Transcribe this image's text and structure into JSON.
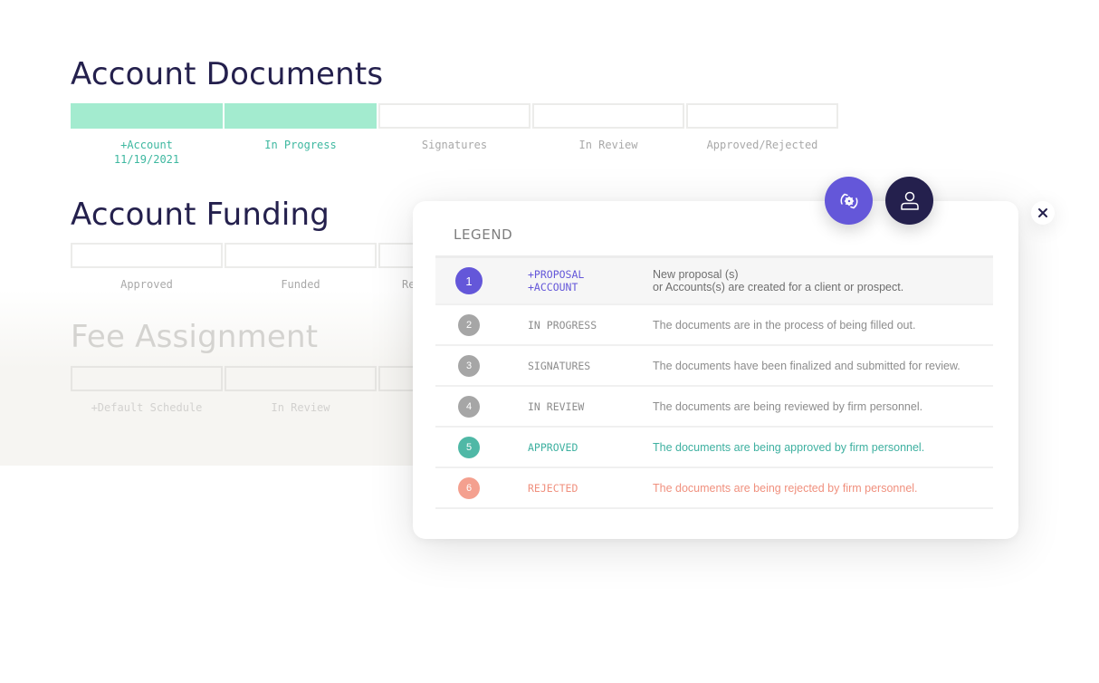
{
  "colors": {
    "navy": "#24204d",
    "purple": "#6457d9",
    "mint": "#a3ebcf",
    "teal": "#3eb8a0",
    "gray": "#a6a6a6",
    "salmon": "#f4a08f",
    "text_gray": "#8a8a8a"
  },
  "sections": [
    {
      "title": "Account Documents",
      "steps": [
        {
          "label": "+Account",
          "sublabel": "11/19/2021",
          "done": true
        },
        {
          "label": "In Progress",
          "sublabel": "",
          "done": true
        },
        {
          "label": "Signatures",
          "sublabel": "",
          "done": false
        },
        {
          "label": "In Review",
          "sublabel": "",
          "done": false
        },
        {
          "label": "Approved/Rejected",
          "sublabel": "",
          "done": false
        }
      ]
    },
    {
      "title": "Account Funding",
      "steps": [
        {
          "label": "Approved",
          "done": false
        },
        {
          "label": "Funded",
          "done": false
        },
        {
          "label": "Re",
          "done": false
        }
      ]
    },
    {
      "title": "Fee Assignment",
      "steps": [
        {
          "label": "+Default Schedule",
          "done": false
        },
        {
          "label": "In Review",
          "done": false
        },
        {
          "label": "",
          "done": false
        }
      ]
    }
  ],
  "legend": {
    "title": "LEGEND",
    "rows": [
      {
        "number": "1",
        "stage": "+PROPOSAL",
        "stage_line2": "+ACCOUNT",
        "description": "New proposal (s)",
        "description_line2": "or Accounts(s) are created for a client or prospect.",
        "badge_color": "#6457d9",
        "stage_color": "#6457d9",
        "desc_color": "#6e6e6e"
      },
      {
        "number": "2",
        "stage": "IN PROGRESS",
        "description": "The documents  are in the process of being filled out.",
        "badge_color": "#a6a6a6",
        "stage_color": "#8d8d8d",
        "desc_color": "#8d8d8d"
      },
      {
        "number": "3",
        "stage": "SIGNATURES",
        "description": "The documents  have been finalized and submitted for review.",
        "badge_color": "#a6a6a6",
        "stage_color": "#8d8d8d",
        "desc_color": "#8d8d8d"
      },
      {
        "number": "4",
        "stage": "IN REVIEW",
        "description": "The documents  are being reviewed by firm personnel.",
        "badge_color": "#a6a6a6",
        "stage_color": "#8d8d8d",
        "desc_color": "#8d8d8d"
      },
      {
        "number": "5",
        "stage": "APPROVED",
        "description": "The documents  are being approved by firm personnel.",
        "badge_color": "#4fb8a6",
        "stage_color": "#3eb0a0",
        "desc_color": "#3eb0a0"
      },
      {
        "number": "6",
        "stage": "REJECTED",
        "description": "The documents  are being rejected by firm personnel.",
        "badge_color": "#f4a08f",
        "stage_color": "#f0907e",
        "desc_color": "#f0907e"
      }
    ]
  },
  "actions": {
    "settings_icon": "settings-sync-icon",
    "user_icon": "user-icon",
    "close_icon": "close-icon"
  }
}
